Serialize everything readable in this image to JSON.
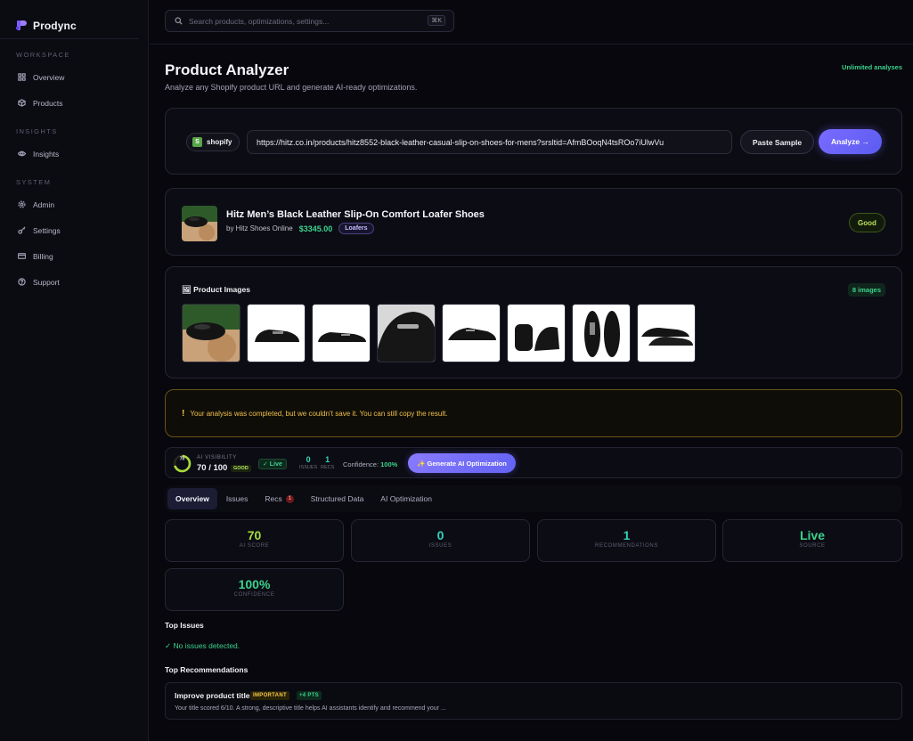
{
  "app": {
    "name": "Prodync"
  },
  "sidebar": {
    "sections": [
      {
        "label": "WORKSPACE",
        "items": [
          {
            "label": "Overview",
            "icon": "grid-icon"
          },
          {
            "label": "Products",
            "icon": "box-icon"
          }
        ]
      },
      {
        "label": "INSIGHTS",
        "items": [
          {
            "label": "Insights",
            "icon": "eye-icon"
          }
        ]
      },
      {
        "label": "SYSTEM",
        "items": [
          {
            "label": "Admin",
            "icon": "gear-icon"
          },
          {
            "label": "Settings",
            "icon": "key-icon"
          },
          {
            "label": "Billing",
            "icon": "card-icon"
          },
          {
            "label": "Support",
            "icon": "help-icon"
          }
        ]
      }
    ]
  },
  "search": {
    "placeholder": "Search products, optimizations, settings...",
    "shortcut": "⌘K"
  },
  "header": {
    "title": "Product Analyzer",
    "subtitle": "Analyze any Shopify product URL and generate AI-ready optimizations.",
    "plan": "Unlimited analyses"
  },
  "analyzer": {
    "platform": "shopify",
    "url": "https://hitz.co.in/products/hitz8552-black-leather-casual-slip-on-shoes-for-mens?srsltid=AfmBOoqN4tsROo7iUlwVu",
    "paste_label": "Paste Sample",
    "analyze_label": "Analyze →"
  },
  "product": {
    "title": "Hitz Men’s Black Leather Slip-On Comfort Loafer Shoes",
    "vendor": "by Hitz Shoes Online",
    "price": "$3345.00",
    "category": "Loafers",
    "rating": "Good"
  },
  "images": {
    "title": "🖼 Product Images",
    "count": "8 images",
    "total": 8
  },
  "alert": {
    "icon": "!",
    "message": "Your analysis was completed, but we couldn’t save it. You can still copy the result."
  },
  "visibility": {
    "label": "AI VISIBILITY",
    "ring_value": "70",
    "score": "70 / 100",
    "score_fraction": 0.7,
    "grade": "GOOD",
    "live": "✓ Live",
    "issues_value": "0",
    "issues_label": "ISSUES",
    "recs_value": "1",
    "recs_label": "RECS",
    "confidence_label": "Confidence:",
    "confidence_value": "100%",
    "generate_label": "✨ Generate AI Optimization"
  },
  "tabs": [
    {
      "label": "Overview",
      "active": true
    },
    {
      "label": "Issues"
    },
    {
      "label": "Recs",
      "badge": "1"
    },
    {
      "label": "Structured Data"
    },
    {
      "label": "AI Optimization"
    }
  ],
  "stats": [
    {
      "value": "70",
      "label": "AI SCORE",
      "color": "#a6dc3c"
    },
    {
      "value": "0",
      "label": "ISSUES",
      "color": "#35d2b6"
    },
    {
      "value": "1",
      "label": "RECOMMENDATIONS",
      "color": "#35d2b6"
    },
    {
      "value": "Live",
      "label": "SOURCE",
      "color": "#3cd28c"
    },
    {
      "value": "100%",
      "label": "CONFIDENCE",
      "color": "#3cd28c"
    }
  ],
  "top_issues": {
    "heading": "Top Issues",
    "empty": "✓ No issues detected."
  },
  "top_recs": {
    "heading": "Top Recommendations",
    "items": [
      {
        "title": "Improve product title",
        "priority": "IMPORTANT",
        "points": "+4 PTS",
        "description": "Your title scored 6/10. A strong, descriptive title helps AI assistants identify and recommend your ..."
      }
    ]
  }
}
